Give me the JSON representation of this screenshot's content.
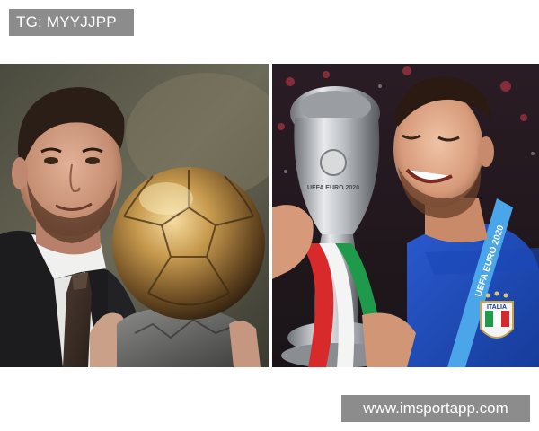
{
  "watermark": {
    "label": "TG: MYYJJPP"
  },
  "site": {
    "url": "www.imsportapp.com"
  },
  "right_photo": {
    "trophy_text": "UEFA EURO 2020",
    "ribbon_text": "UEFA EURO 2020",
    "crest_text": "ITALIA"
  },
  "colors": {
    "label_bg": "#8c8c8c",
    "italy_blue": "#1f4fbf",
    "gold": "#c9a24a"
  }
}
